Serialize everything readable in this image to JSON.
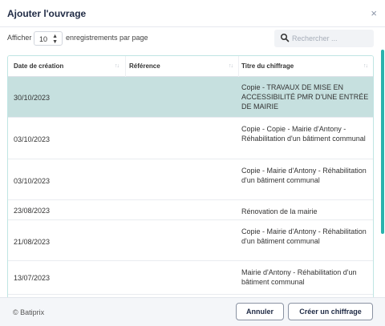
{
  "header": {
    "title": "Ajouter l'ouvrage",
    "close_glyph": "×"
  },
  "controls": {
    "show_label": "Afficher",
    "page_length": "10",
    "per_page_label": "enregistrements par page",
    "search_placeholder": "Rechercher ..."
  },
  "table": {
    "columns": [
      "Date de création",
      "Référence",
      "Titre du chiffrage"
    ],
    "rows": [
      {
        "date": "30/10/2023",
        "reference": "",
        "title": "Copie - TRAVAUX DE MISE EN ACCESSIBILITÉ PMR D'UNE ENTRÉE DE MAIRIE",
        "selected": true
      },
      {
        "date": "03/10/2023",
        "reference": "",
        "title": "Copie - Copie - Mairie d'Antony - Réhabilitation d'un bâtiment communal",
        "selected": false
      },
      {
        "date": "03/10/2023",
        "reference": "",
        "title": "Copie - Mairie d'Antony - Réhabilitation d'un bâtiment communal",
        "selected": false
      },
      {
        "date": "23/08/2023",
        "reference": "",
        "title": "Rénovation de la mairie",
        "selected": false
      },
      {
        "date": "21/08/2023",
        "reference": "",
        "title": "Copie - Mairie d'Antony - Réhabilitation d'un bâtiment communal",
        "selected": false
      },
      {
        "date": "13/07/2023",
        "reference": "",
        "title": "Mairie d'Antony - Réhabilitation d'un bâtiment communal",
        "selected": false
      }
    ]
  },
  "footer": {
    "copyright": "© Batiprix",
    "cancel_label": "Annuler",
    "create_label": "Créer un chiffrage"
  },
  "colors": {
    "selected_row": "#c6e0df",
    "accent": "#2bb3ad"
  }
}
